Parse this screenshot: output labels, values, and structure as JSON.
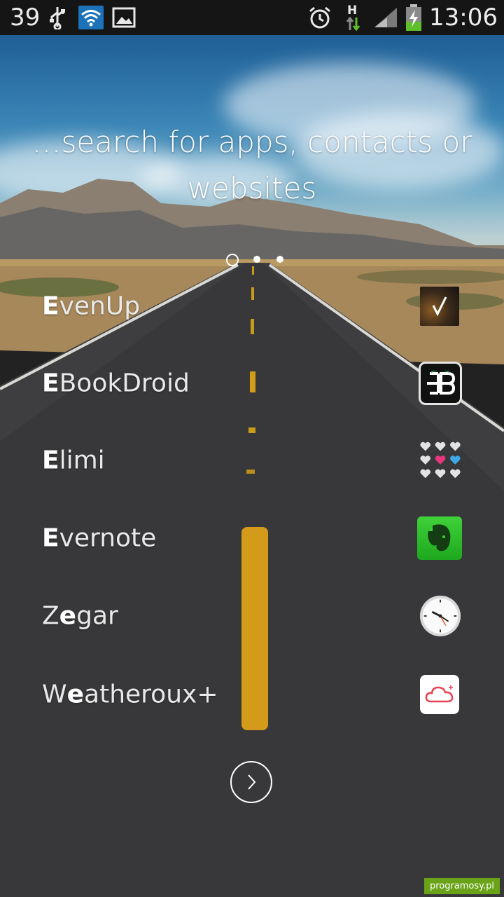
{
  "status_bar": {
    "temperature": "39",
    "time": "13:06",
    "network_type": "H",
    "icons": [
      "usb-icon",
      "wifi-icon",
      "image-icon",
      "alarm-icon",
      "h-signal-icon",
      "signal-bars-icon",
      "battery-charging-icon"
    ]
  },
  "hint": {
    "text": "…search for apps, contacts or websites"
  },
  "pager": {
    "pages": 3,
    "current": 1
  },
  "apps": [
    {
      "prefix": "E",
      "rest": "venUp",
      "icon": "evenup-icon"
    },
    {
      "prefix": "E",
      "rest": "BookDroid",
      "icon": "ebookdroid-icon"
    },
    {
      "prefix": "E",
      "rest": "limi",
      "icon": "elimi-icon"
    },
    {
      "prefix": "E",
      "rest": "vernote",
      "icon": "evernote-icon"
    },
    {
      "pre": "Z",
      "prefix": "e",
      "rest": "gar",
      "icon": "clock-icon"
    },
    {
      "pre": "W",
      "prefix": "e",
      "rest": "atheroux+",
      "icon": "weather-icon"
    }
  ],
  "next": {
    "icon": "chevron-right-icon"
  },
  "watermark": "programosy.pl",
  "colors": {
    "status_bg": "#151515",
    "wifi_accent": "#1b72b8",
    "evernote_green": "#2dbd2d",
    "elimi_pink": "#e8377f",
    "elimi_blue": "#3ea8e6"
  }
}
